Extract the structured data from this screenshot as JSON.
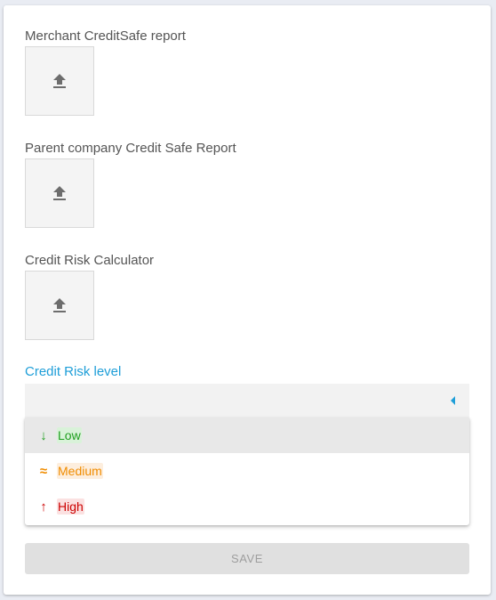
{
  "uploads": [
    {
      "label": "Merchant CreditSafe report",
      "icon": "upload-icon"
    },
    {
      "label": "Parent company Credit Safe Report",
      "icon": "upload-icon"
    },
    {
      "label": "Credit Risk Calculator",
      "icon": "upload-icon"
    }
  ],
  "risk_select": {
    "label": "Credit Risk level",
    "value": "",
    "accent_color": "#1e9ed8",
    "options": [
      {
        "label": "Low",
        "icon": "arrow-down-icon",
        "icon_glyph": "↓",
        "color": "#1e9e1e",
        "highlight": "#d9f2d9",
        "selected": true
      },
      {
        "label": "Medium",
        "icon": "approx-icon",
        "icon_glyph": "≈",
        "color": "#f08c00",
        "highlight": "#fdeede",
        "selected": false
      },
      {
        "label": "High",
        "icon": "arrow-up-icon",
        "icon_glyph": "↑",
        "color": "#cc0000",
        "highlight": "#fbe1e1",
        "selected": false
      }
    ]
  },
  "actions": {
    "save_label": "SAVE",
    "save_enabled": false
  }
}
